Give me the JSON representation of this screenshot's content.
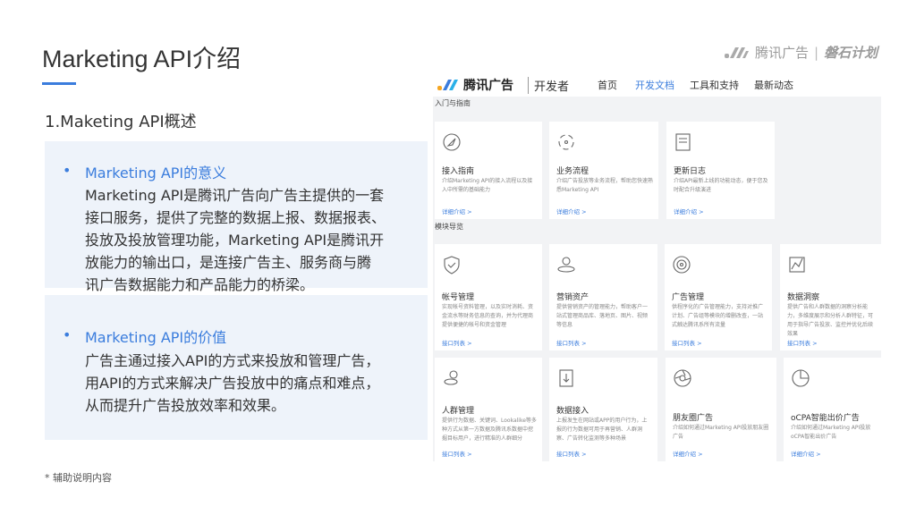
{
  "slide": {
    "title": "Marketing API介绍",
    "subtitle": "1.Maketing API概述",
    "brand": "腾讯广告",
    "brand_sub": "磐石计划",
    "footnote": "* 辅助说明内容"
  },
  "sections": [
    {
      "bullet": "•",
      "heading": "Marketing API的意义",
      "lines": [
        "Marketing API是腾讯广告向广告主提供的一套",
        "接口服务，提供了完整的数据上报、数据报表、",
        "投放及投放管理功能，Marketing API是腾讯开",
        "放能力的输出口，是连接广告主、服务商与腾",
        "讯广告数据能力和产品能力的桥梁。"
      ]
    },
    {
      "bullet": "•",
      "heading": "Marketing API的价值",
      "lines": [
        "广告主通过接入API的方式来投放和管理广告，",
        "用API的方式来解决广告投放中的痛点和难点，",
        "从而提升广告投放效率和效果。"
      ]
    }
  ],
  "screenshot": {
    "logo": "腾讯广告",
    "dev": "开发者",
    "nav": [
      "首页",
      "开发文档",
      "工具和支持",
      "最新动态"
    ],
    "section1": "入门与指南",
    "section2": "模块导览",
    "cards": [
      {
        "title": "接入指南",
        "desc": "介绍Marketing API的接入流程以及接入中所需的基础能力",
        "link": "详细介绍 >"
      },
      {
        "title": "业务流程",
        "desc": "介绍广告投放等业务流程，帮助您快速熟悉Marketing API",
        "link": "详细介绍 >"
      },
      {
        "title": "更新日志",
        "desc": "介绍API最新上线的功能动态，便于您及时配合升级演进",
        "link": "详细介绍 >"
      },
      {
        "title": "帐号管理",
        "desc": "实现帐号资料管理，以及实时消耗、资金流水等财务信息的查询，并为代理商提供便捷的帐号和资金管理",
        "link": "接口列表 >"
      },
      {
        "title": "营销资产",
        "desc": "提供营销资产的管理能力，帮助客户一站式管理商品库、落地页、图片、视频等信息",
        "link": "接口列表 >"
      },
      {
        "title": "广告管理",
        "desc": "供程序化的广告管理能力，支持对推广计划、广告组等模块的增删改查，一站式触达腾讯系所有流量",
        "link": "接口列表 >"
      },
      {
        "title": "数据洞察",
        "desc": "提供广告和人群数据的洞察分析能力，多维度展示和分析人群特征，可用于指导广告投放、监控并优化后续效果",
        "link": "接口列表 >"
      },
      {
        "title": "人群管理",
        "desc": "提供行为数据、关键词、Lookalike等多种方式从第一方数据及腾讯系数据中挖掘目标用户，进行精准的人群细分",
        "link": "接口列表 >"
      },
      {
        "title": "数据接入",
        "desc": "上报发生在网站或APP的用户行为，上报的行为数据可用于再营销、人群洞察、广告转化监测等多种场景",
        "link": "接口列表 >"
      },
      {
        "title": "朋友圈广告",
        "desc": "介绍如何通过Marketing API投放朋友圈广告",
        "link": "详细介绍 >"
      },
      {
        "title": "oCPA智能出价广告",
        "desc": "介绍如何通过Marketing API投放oCPA智能出价广告",
        "link": "详细介绍 >"
      }
    ]
  },
  "colors": {
    "accent": "#3b7ddd",
    "box": "#eef3fa"
  }
}
